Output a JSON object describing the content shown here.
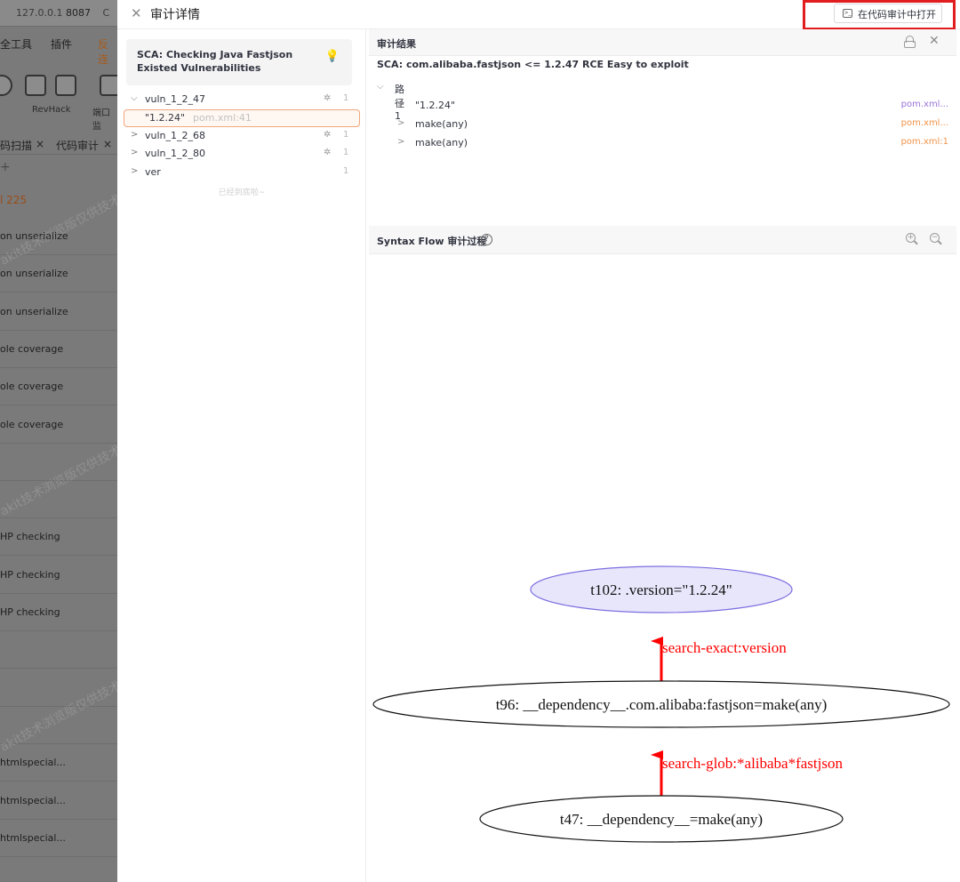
{
  "background_app": {
    "address_prefix": "127.0.0.1",
    "address_port": "8087",
    "address_extra": "C",
    "menu": [
      "全工具",
      "插件",
      "反连"
    ],
    "tools": [
      "RevHack",
      "端口监"
    ],
    "tabs": [
      "码扫描",
      "×",
      "代码审计",
      "×"
    ],
    "add_tab": "+",
    "count_prefix": "l",
    "count_value": "225",
    "rows": [
      "on unserialize",
      "on unserialize",
      "on unserialize",
      "ole coverage",
      "ole coverage",
      "ole coverage",
      "",
      "",
      "HP checking",
      "HP checking",
      "HP checking",
      "",
      "",
      "",
      "htmlspecial...",
      "htmlspecial...",
      "htmlspecial..."
    ],
    "watermark": "akit技术浏览版仅供技术"
  },
  "drawer": {
    "close_icon": "close-icon",
    "title": "审计详情",
    "open_button_label": "在代码审计中打开",
    "open_button_icon": "terminal-icon",
    "highlight_color": "#e11d1d"
  },
  "left_panel": {
    "rule_title": "SCA: Checking Java Fastjson Existed Vulnerabilities",
    "rule_icon": "lightbulb-icon",
    "tree": [
      {
        "label": "vuln_1_2_47",
        "expanded": true,
        "count": "1"
      },
      {
        "label": "vuln_1_2_68",
        "expanded": false,
        "count": "1"
      },
      {
        "label": "vuln_1_2_80",
        "expanded": false,
        "count": "1"
      },
      {
        "label": "ver",
        "expanded": false,
        "count": "1"
      }
    ],
    "selected_item": {
      "value": "\"1.2.24\"",
      "file": "pom.xml:41"
    },
    "end_text": "已经到底啦~"
  },
  "right_panel": {
    "result_header": "审计结果",
    "result_title": "SCA: com.alibaba.fastjson <= 1.2.47 RCE Easy to exploit",
    "path_group": "路径1",
    "paths": [
      {
        "label": "\"1.2.24\"",
        "file": "pom.xml...",
        "color": "#9a73dc"
      },
      {
        "label": "make(any)",
        "file": "pom.xml...",
        "color": "#f0934a"
      },
      {
        "label": "make(any)",
        "file": "pom.xml:1",
        "color": "#f0934a"
      }
    ],
    "flow_header": "Syntax Flow 审计过程",
    "flow_help": "?",
    "graph": {
      "nodes": [
        {
          "id": "t102",
          "label": "t102: .version=\"1.2.24\"",
          "highlight": true
        },
        {
          "id": "t96",
          "label": "t96: __dependency__.com.alibaba:fastjson=make(any)",
          "highlight": false
        },
        {
          "id": "t47",
          "label": "t47: __dependency__=make(any)",
          "highlight": false
        }
      ],
      "edges": [
        {
          "from": "t96",
          "to": "t102",
          "label": "search-exact:version"
        },
        {
          "from": "t47",
          "to": "t96",
          "label": "search-glob:*alibaba*fastjson"
        }
      ],
      "edge_color": "#ff0000",
      "highlight_fill": "#e8e6fb",
      "highlight_stroke": "#7b6fe0"
    }
  }
}
